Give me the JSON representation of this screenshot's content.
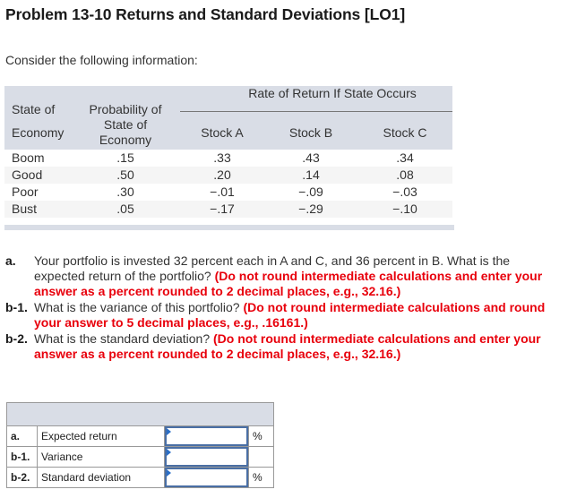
{
  "title": "Problem 13-10 Returns and Standard Deviations [LO1]",
  "intro": "Consider the following information:",
  "data_table": {
    "header": {
      "state_line1": "State of",
      "state_line2": "Economy",
      "probability": "Probability of State of Economy",
      "rate_group": "Rate of Return If State Occurs",
      "stock_a": "Stock A",
      "stock_b": "Stock B",
      "stock_c": "Stock C"
    },
    "rows": [
      {
        "state": "Boom",
        "probability": ".15",
        "stock_a": ".33",
        "stock_b": ".43",
        "stock_c": ".34"
      },
      {
        "state": "Good",
        "probability": ".50",
        "stock_a": ".20",
        "stock_b": ".14",
        "stock_c": ".08"
      },
      {
        "state": "Poor",
        "probability": ".30",
        "stock_a": "−.01",
        "stock_b": "−.09",
        "stock_c": "−.03"
      },
      {
        "state": "Bust",
        "probability": ".05",
        "stock_a": "−.17",
        "stock_b": "−.29",
        "stock_c": "−.10"
      }
    ]
  },
  "questions": [
    {
      "label": "a.",
      "text": "Your portfolio is invested 32 percent each in A and C, and 36 percent in B. What is the expected return of the portfolio?",
      "instruction": "(Do not round intermediate calculations and enter your answer as a percent rounded to 2 decimal places, e.g., 32.16.)"
    },
    {
      "label": "b-1.",
      "text": "What is the variance of this portfolio?",
      "instruction": "(Do not round intermediate calculations and round your answer to 5 decimal places, e.g., .16161.)"
    },
    {
      "label": "b-2.",
      "text": "What is the standard deviation?",
      "instruction": "(Do not round intermediate calculations and enter your answer as a percent rounded to 2 decimal places, e.g., 32.16.)"
    }
  ],
  "answer_table": {
    "rows": [
      {
        "label": "a.",
        "description": "Expected return",
        "value": "",
        "unit": "%"
      },
      {
        "label": "b-1.",
        "description": "Variance",
        "value": "",
        "unit": ""
      },
      {
        "label": "b-2.",
        "description": "Standard deviation",
        "value": "",
        "unit": "%"
      }
    ]
  },
  "colors": {
    "header_band": "#d9dde6",
    "instruction_red": "#e8000c",
    "input_border": "#4a6fa5"
  }
}
